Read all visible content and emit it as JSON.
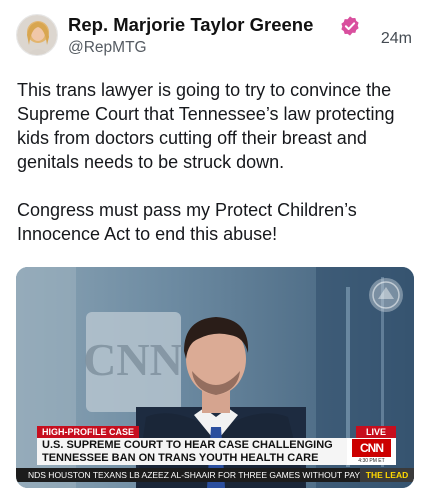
{
  "post": {
    "display_name": "Rep. Marjorie Taylor Greene",
    "handle": "@RepMTG",
    "timestamp": "24m",
    "verified_color": "#d94f9e",
    "paragraphs": [
      "This trans lawyer is going to try to convince the Supreme Court that Tennessee’s law protecting kids from doctors cutting off their breast and genitals needs to be struck down.",
      "Congress must pass my Protect Children’s Innocence Act to end this abuse!"
    ]
  },
  "media": {
    "type": "video-frame",
    "logo_on_wall": "CNN",
    "lower_third": {
      "tag": "HIGH-PROFILE CASE",
      "live_tag": "LIVE",
      "headline_line1": "U.S. SUPREME COURT TO HEAR CASE CHALLENGING",
      "headline_line2": "TENNESSEE BAN ON TRANS YOUTH HEALTH CARE",
      "network": "CNN",
      "clock": "4:30 PM ET",
      "ticker": "NDS HOUSTON TEXANS LB AZEEZ AL-SHAAIR FOR THREE GAMES WITHOUT PAY FOR A",
      "show_name": "THE LEAD"
    }
  }
}
